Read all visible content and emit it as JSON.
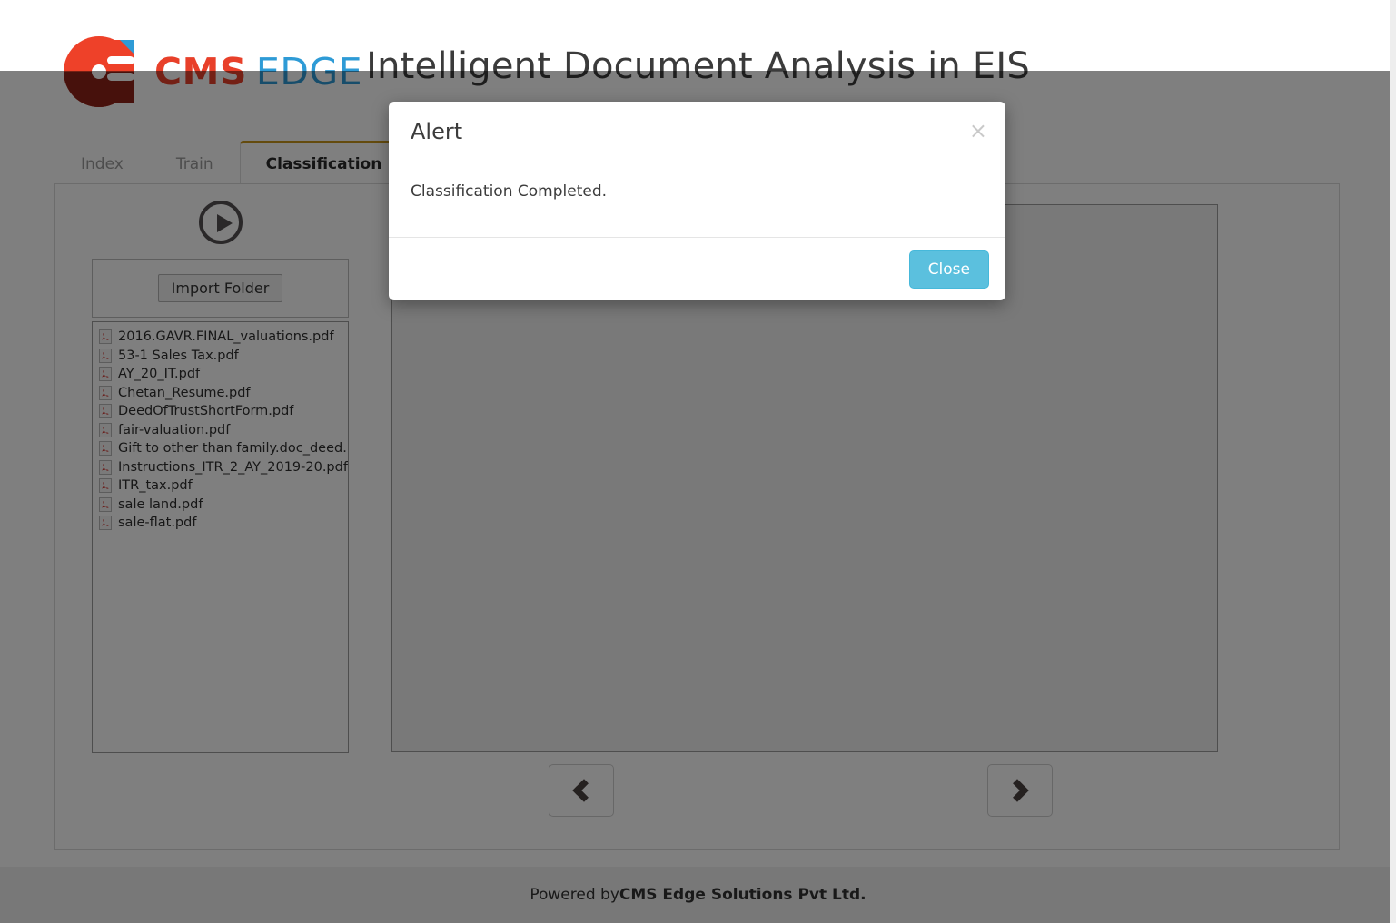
{
  "brand": {
    "logo_icon": "cms-edge-logo-icon",
    "name_primary": "CMS",
    "name_secondary": "EDGE",
    "color_primary": "#e8402a",
    "color_secondary": "#2e9bd6"
  },
  "header": {
    "title": "Intelligent Document Analysis in EIS"
  },
  "tabs": [
    {
      "label": "Index",
      "active": false
    },
    {
      "label": "Train",
      "active": false
    },
    {
      "label": "Classification",
      "active": true
    }
  ],
  "tab_accent_color": "#c8961d",
  "toolbar": {
    "play_icon": "play-circle-icon",
    "import_label": "Import Folder"
  },
  "files": [
    {
      "icon": "pdf-file-icon",
      "name": "2016.GAVR.FINAL_valuations.pdf"
    },
    {
      "icon": "pdf-file-icon",
      "name": "53-1 Sales Tax.pdf"
    },
    {
      "icon": "pdf-file-icon",
      "name": "AY_20_IT.pdf"
    },
    {
      "icon": "pdf-file-icon",
      "name": "Chetan_Resume.pdf"
    },
    {
      "icon": "pdf-file-icon",
      "name": "DeedOfTrustShortForm.pdf"
    },
    {
      "icon": "pdf-file-icon",
      "name": "fair-valuation.pdf"
    },
    {
      "icon": "pdf-file-icon",
      "name": "Gift to other than family.doc_deed.pdf"
    },
    {
      "icon": "pdf-file-icon",
      "name": "Instructions_ITR_2_AY_2019-20.pdf"
    },
    {
      "icon": "pdf-file-icon",
      "name": "ITR_tax.pdf"
    },
    {
      "icon": "pdf-file-icon",
      "name": "sale land.pdf"
    },
    {
      "icon": "pdf-file-icon",
      "name": "sale-flat.pdf"
    }
  ],
  "preview": {
    "content": ""
  },
  "pager": {
    "prev_icon": "chevron-left-icon",
    "next_icon": "chevron-right-icon"
  },
  "footer": {
    "prefix": "Powered by ",
    "company": "CMS Edge Solutions Pvt Ltd."
  },
  "modal": {
    "title": "Alert",
    "close_icon": "close-x-icon",
    "message": "Classification Completed.",
    "close_button_label": "Close",
    "close_button_color": "#5bc0de"
  }
}
